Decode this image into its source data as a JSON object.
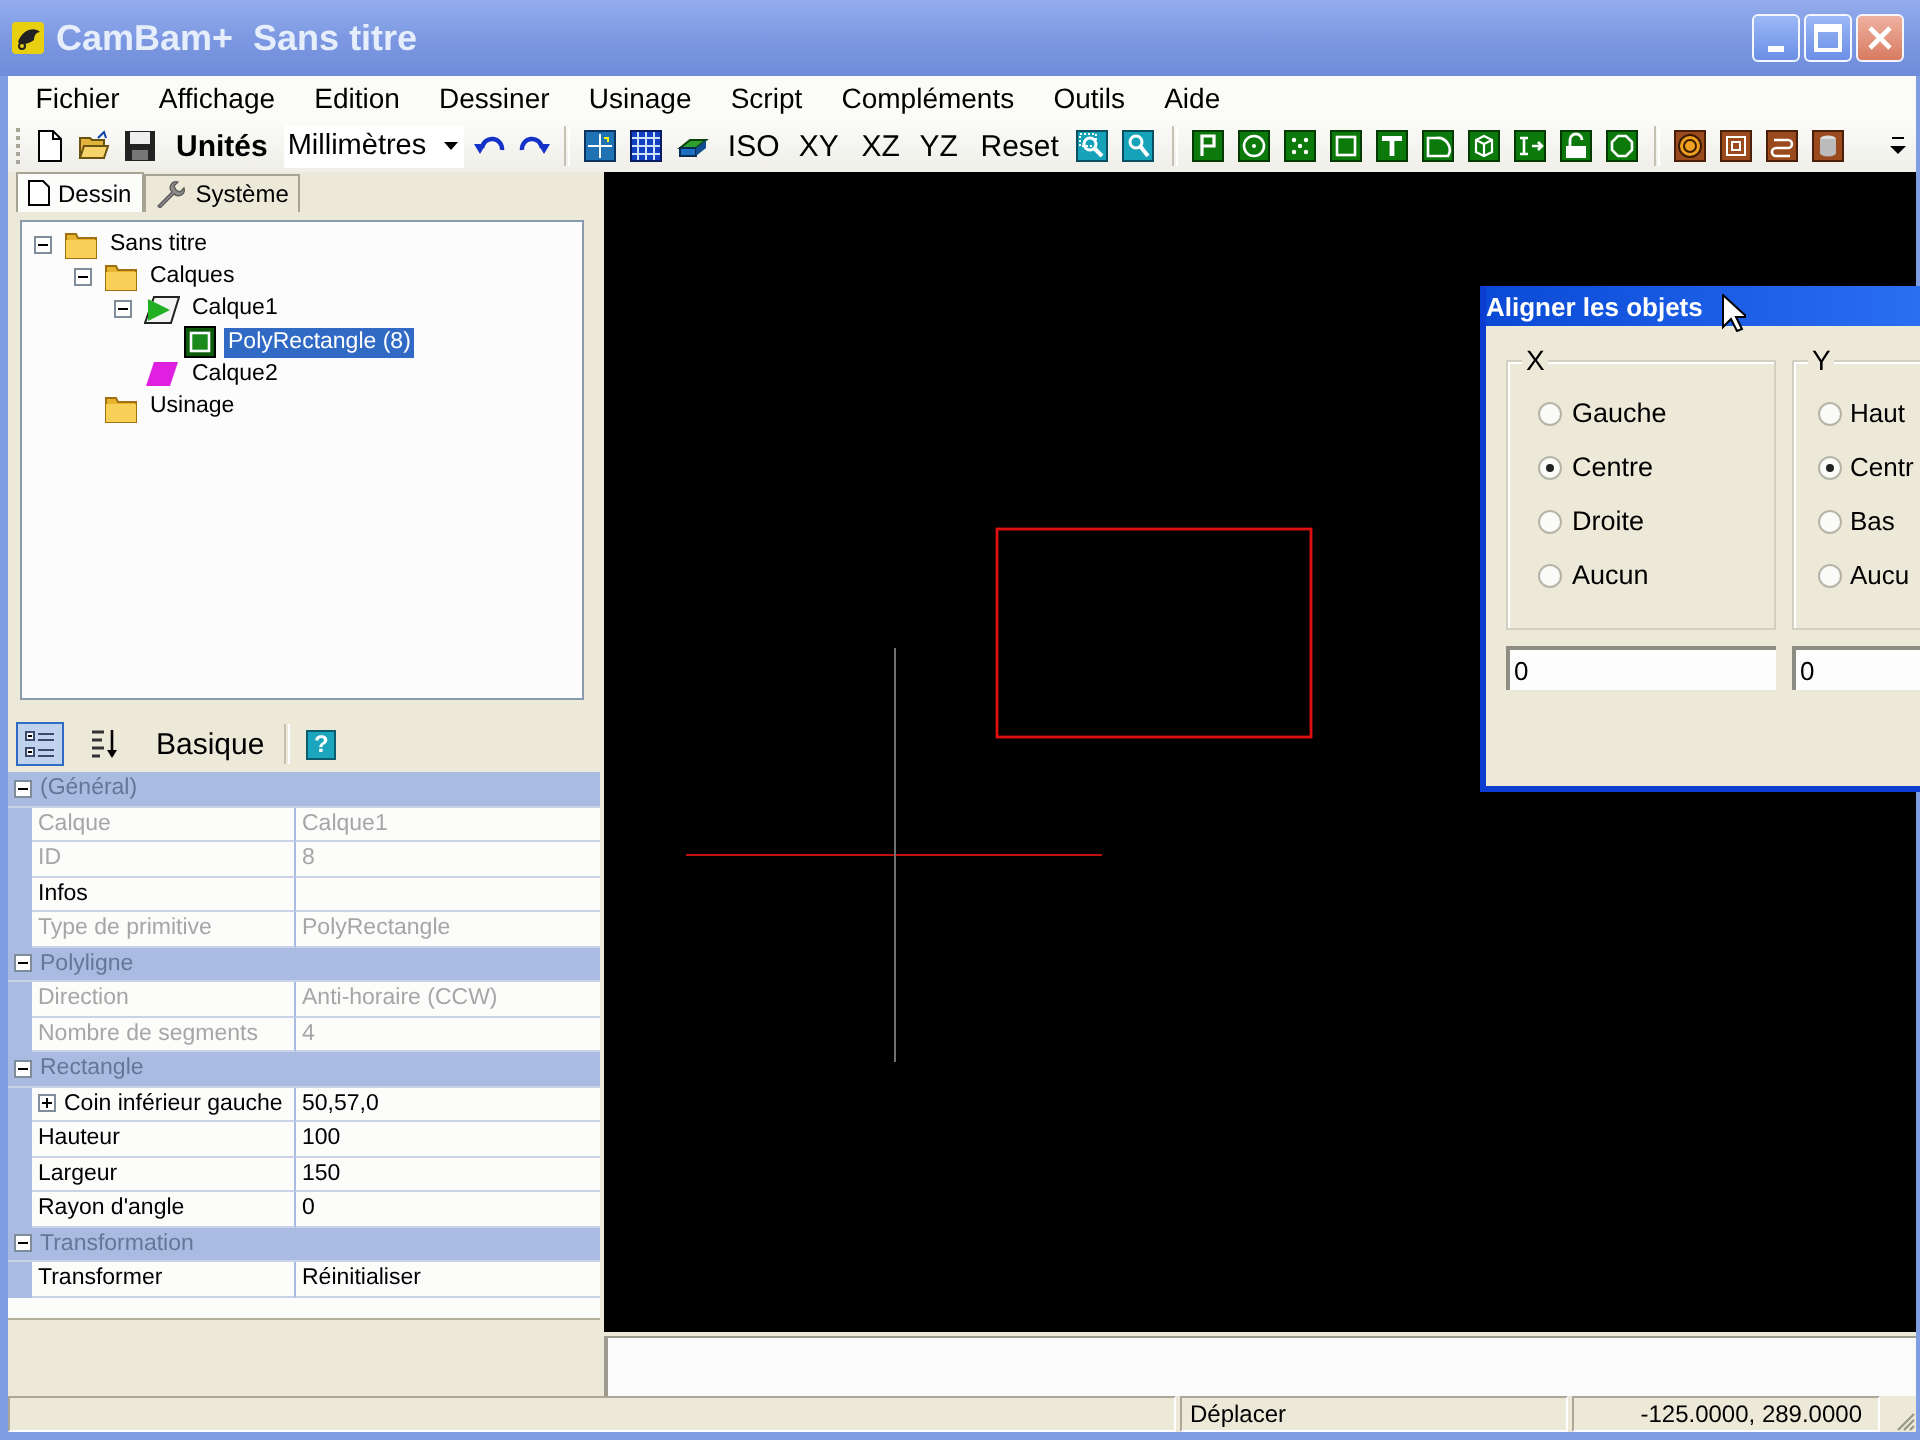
{
  "window": {
    "title": "CamBam+  Sans titre"
  },
  "menu": [
    "Fichier",
    "Affichage",
    "Edition",
    "Dessiner",
    "Usinage",
    "Script",
    "Compléments",
    "Outils",
    "Aide"
  ],
  "toolbar": {
    "units_label": "Unités",
    "units": "Millimètres",
    "views": [
      "ISO",
      "XY",
      "XZ",
      "YZ",
      "Reset"
    ]
  },
  "tabs": [
    {
      "label": "Dessin",
      "selected": true
    },
    {
      "label": "Système",
      "selected": false
    }
  ],
  "tree": [
    {
      "label": "Sans titre",
      "kind": "folder",
      "expanded": true,
      "selected": false,
      "children": [
        {
          "label": "Calques",
          "kind": "folder",
          "expanded": true,
          "selected": false,
          "children": [
            {
              "label": "Calque1",
              "kind": "layer",
              "color": "#22b022",
              "active": true,
              "expanded": true,
              "selected": false,
              "children": [
                {
                  "label": "PolyRectangle (8)",
                  "kind": "shape",
                  "selected": true
                }
              ]
            },
            {
              "label": "Calque2",
              "kind": "layer",
              "color": "#e020e0",
              "active": false,
              "selected": false
            }
          ]
        },
        {
          "label": "Usinage",
          "kind": "folder",
          "selected": false
        }
      ]
    }
  ],
  "properties": {
    "view_buttons": [
      {
        "kind": "categorized",
        "selected": true
      },
      {
        "kind": "alphabetical",
        "selected": false
      }
    ],
    "mode": "Basique",
    "help": "?",
    "categories": [
      {
        "name": "(Général)",
        "expanded": true,
        "rows": [
          {
            "kind": "field",
            "label": "Calque",
            "value": "Calque1",
            "disabled": true
          },
          {
            "kind": "field",
            "label": "ID",
            "value": "8",
            "disabled": true
          },
          {
            "kind": "field",
            "label": "Infos",
            "disabled": false
          },
          {
            "kind": "field",
            "label": "Type de primitive",
            "value": "PolyRectangle",
            "disabled": true
          }
        ]
      },
      {
        "name": "Polyligne",
        "expanded": true,
        "rows": [
          {
            "kind": "field",
            "label": "Direction",
            "value": "Anti-horaire (CCW)",
            "disabled": true
          },
          {
            "kind": "field",
            "label": "Nombre de segments",
            "value": "4",
            "disabled": true
          }
        ]
      },
      {
        "name": "Rectangle",
        "expanded": true,
        "rows": [
          {
            "kind": "group",
            "label": "Coin inférieur gauche",
            "value": "50,57,0",
            "disabled": false,
            "expanded": false
          },
          {
            "kind": "field",
            "label": "Hauteur",
            "value": "100",
            "disabled": false
          },
          {
            "kind": "field",
            "label": "Largeur",
            "value": "150",
            "disabled": false
          },
          {
            "kind": "field",
            "label": "Rayon d'angle",
            "value": "0",
            "disabled": false
          }
        ]
      },
      {
        "name": "Transformation",
        "expanded": true,
        "rows": [
          {
            "kind": "field",
            "label": "Transformer",
            "value": "Réinitialiser",
            "disabled": false
          }
        ]
      }
    ]
  },
  "dialog": {
    "title": "Aligner les objets",
    "groups": [
      {
        "label": "X",
        "options": [
          {
            "label": "Gauche",
            "selected": false
          },
          {
            "label": "Centre",
            "selected": true
          },
          {
            "label": "Droite",
            "selected": false
          },
          {
            "label": "Aucun",
            "selected": false
          }
        ]
      },
      {
        "label": "Y",
        "options": [
          {
            "label": "Haut",
            "selected": false
          },
          {
            "label": "Centr",
            "selected": true
          },
          {
            "label": "Bas",
            "selected": false
          },
          {
            "label": "Aucu",
            "selected": false
          }
        ]
      }
    ],
    "fields": [
      {
        "value": "0"
      },
      {
        "value": "0"
      }
    ]
  },
  "status_bar": [
    "Déplacer",
    "-125.0000, 289.0000"
  ]
}
